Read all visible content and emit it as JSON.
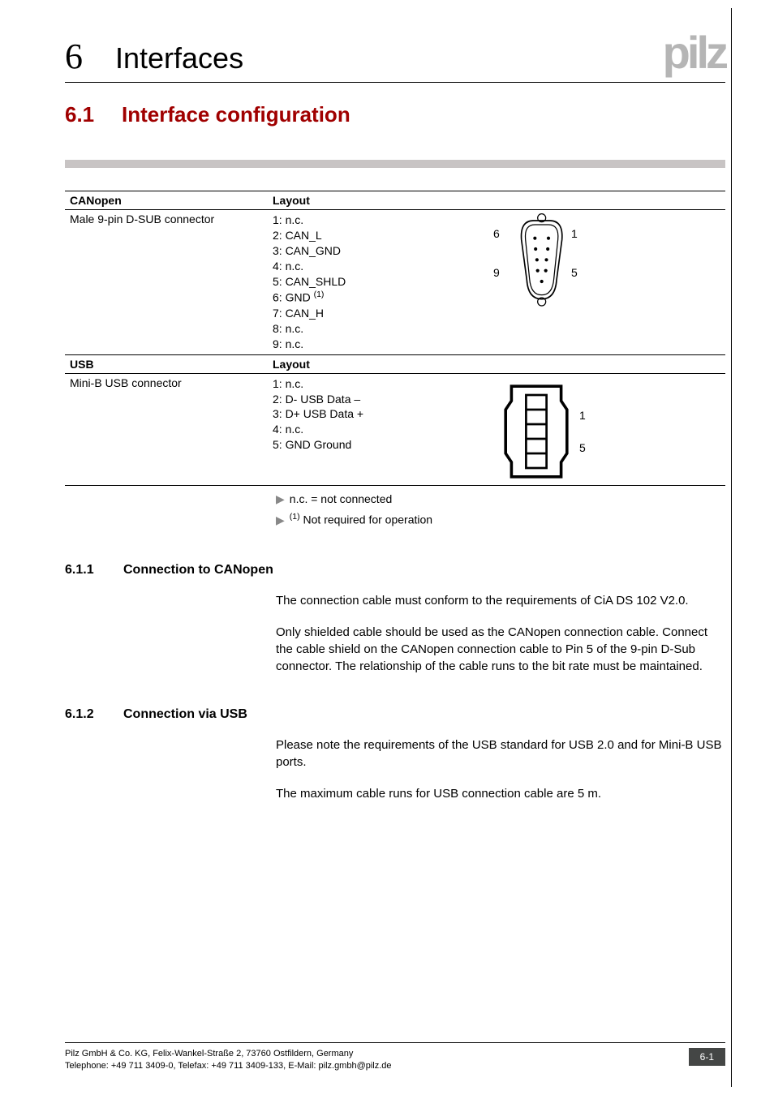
{
  "header": {
    "chapter_num": "6",
    "chapter_title": "Interfaces",
    "logo_text": "pilz"
  },
  "section": {
    "num": "6.1",
    "title": "Interface configuration"
  },
  "table": {
    "canopen_header_left": "CANopen",
    "canopen_header_right": "Layout",
    "canopen_connector": "Male 9-pin D-SUB connector",
    "canopen_pins": {
      "p1": "1: n.c.",
      "p2": "2: CAN_L",
      "p3": "3: CAN_GND",
      "p4": "4: n.c.",
      "p5": "5: CAN_SHLD",
      "p6_a": "6: GND ",
      "p6_sup": "(1)",
      "p7": "7: CAN_H",
      "p8": "8: n.c.",
      "p9": "9: n.c."
    },
    "dsub_labels": {
      "tl": "6",
      "tr": "1",
      "bl": "9",
      "br": "5"
    },
    "usb_header_left": "USB",
    "usb_header_right": "Layout",
    "usb_connector": "Mini-B USB connector",
    "usb_pins": {
      "p1": "1: n.c.",
      "p2": "2: D- USB Data –",
      "p3": "3: D+ USB Data +",
      "p4": "4: n.c.",
      "p5": "5: GND Ground"
    },
    "minib_labels": {
      "top": "1",
      "bottom": "5"
    }
  },
  "footnotes": {
    "f1": "n.c. = not connected",
    "f2_sup": "(1)",
    "f2": " Not required for operation"
  },
  "sub1": {
    "num": "6.1.1",
    "title": "Connection to CANopen",
    "para1": "The connection cable must conform to the requirements of CiA DS 102 V2.0.",
    "para2": "Only shielded cable should be used as the CANopen connection cable. Connect the cable shield on the CANopen connection cable to Pin 5 of the 9-pin D-Sub connector. The relationship of the cable runs to the bit rate must be maintained."
  },
  "sub2": {
    "num": "6.1.2",
    "title": "Connection via USB",
    "para1": "Please note the requirements of the USB standard for USB 2.0 and for Mini-B USB ports.",
    "para2": "The maximum cable runs for USB connection cable are 5 m."
  },
  "footer": {
    "line1": "Pilz GmbH & Co. KG, Felix-Wankel-Straße 2, 73760 Ostfildern, Germany",
    "line2": "Telephone: +49 711 3409-0, Telefax: +49 711 3409-133, E-Mail: pilz.gmbh@pilz.de",
    "page": "6-1"
  }
}
